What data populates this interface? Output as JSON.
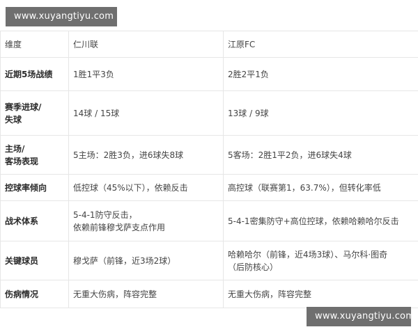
{
  "watermarks": {
    "top": "www.xuyangtiyu.com",
    "bottom": "www.xuyangtiyu.com"
  },
  "table": {
    "headers": [
      "维度",
      "仁川联",
      "江原FC"
    ],
    "rows": [
      {
        "label": "近期5场战绩",
        "a": "1胜1平3负",
        "b": "2胜2平1负"
      },
      {
        "label": "赛季进球/\n失球",
        "a": "14球 / 15球",
        "b": "13球 / 9球"
      },
      {
        "label": "主场/\n客场表现",
        "a": "5主场：2胜3负，进6球失8球",
        "b": "5客场：2胜1平2负，进6球失4球"
      },
      {
        "label": "控球率倾向",
        "a": "低控球（45%以下），依赖反击",
        "b": "高控球（联赛第1，63.7%），但转化率低"
      },
      {
        "label": "战术体系",
        "a": "5-4-1防守反击，\n依赖前锋穆戈萨支点作用",
        "b": "5-4-1密集防守+高位控球，依赖哈赖哈尔反击"
      },
      {
        "label": "关键球员",
        "a": "穆戈萨（前锋，近3场2球）",
        "b": "哈赖哈尔（前锋，近4场3球）、马尔科·图奇\n（后防核心）"
      },
      {
        "label": "伤病情况",
        "a": "无重大伤病，阵容完整",
        "b": "无重大伤病，阵容完整"
      }
    ]
  }
}
